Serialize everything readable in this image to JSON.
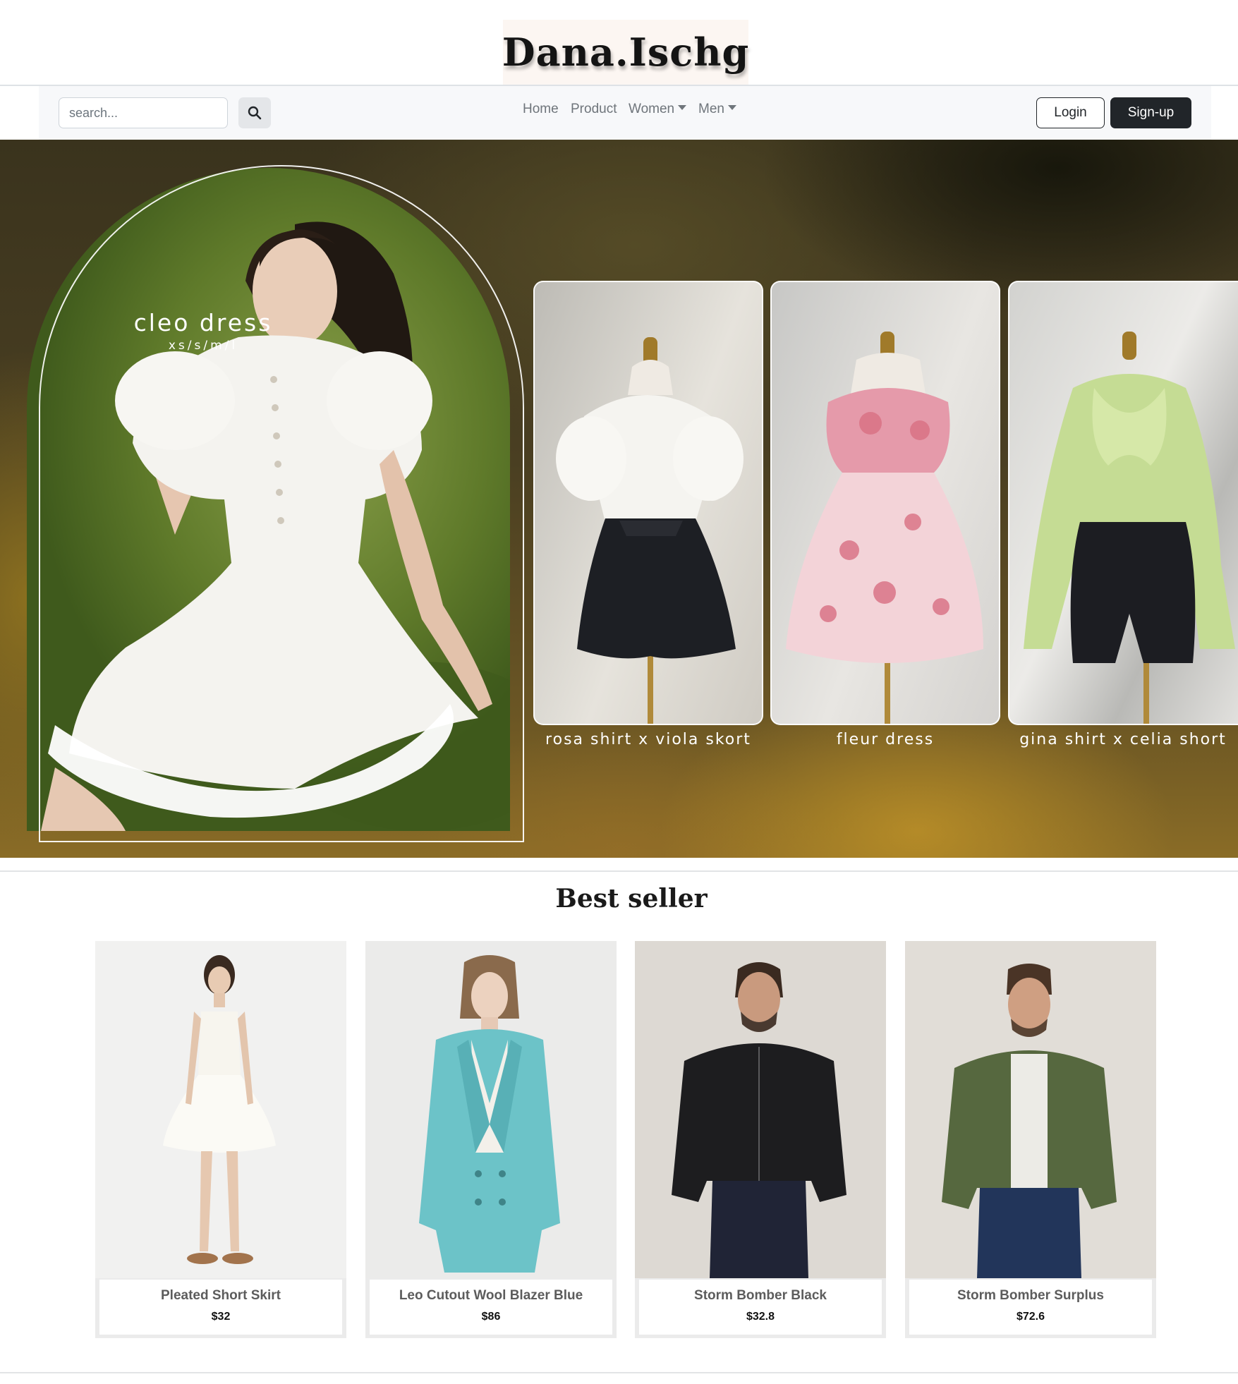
{
  "brand": {
    "logo": "Dana.Ischg"
  },
  "navbar": {
    "search_placeholder": "search...",
    "links": [
      {
        "label": "Home"
      },
      {
        "label": "Product"
      },
      {
        "label": "Women",
        "dropdown": true
      },
      {
        "label": "Men",
        "dropdown": true
      }
    ],
    "login_label": "Login",
    "signup_label": "Sign-up"
  },
  "hero": {
    "featured": {
      "title": "cleo dress",
      "sizes": "xs/s/m/l"
    },
    "cards": [
      {
        "caption": "rosa shirt x viola skort"
      },
      {
        "caption": "fleur dress"
      },
      {
        "caption": "gina shirt x celia short"
      }
    ]
  },
  "best_seller": {
    "title": "Best seller",
    "products": [
      {
        "name": "Pleated Short Skirt",
        "price": "$32"
      },
      {
        "name": "Leo Cutout Wool Blazer Blue",
        "price": "$86"
      },
      {
        "name": "Storm Bomber Black",
        "price": "$32.8"
      },
      {
        "name": "Storm Bomber Surplus",
        "price": "$72.6"
      }
    ]
  },
  "colors": {
    "navbar_bg": "#f7f8fa",
    "primary_dark": "#212529",
    "link_gray": "#6f757b"
  }
}
